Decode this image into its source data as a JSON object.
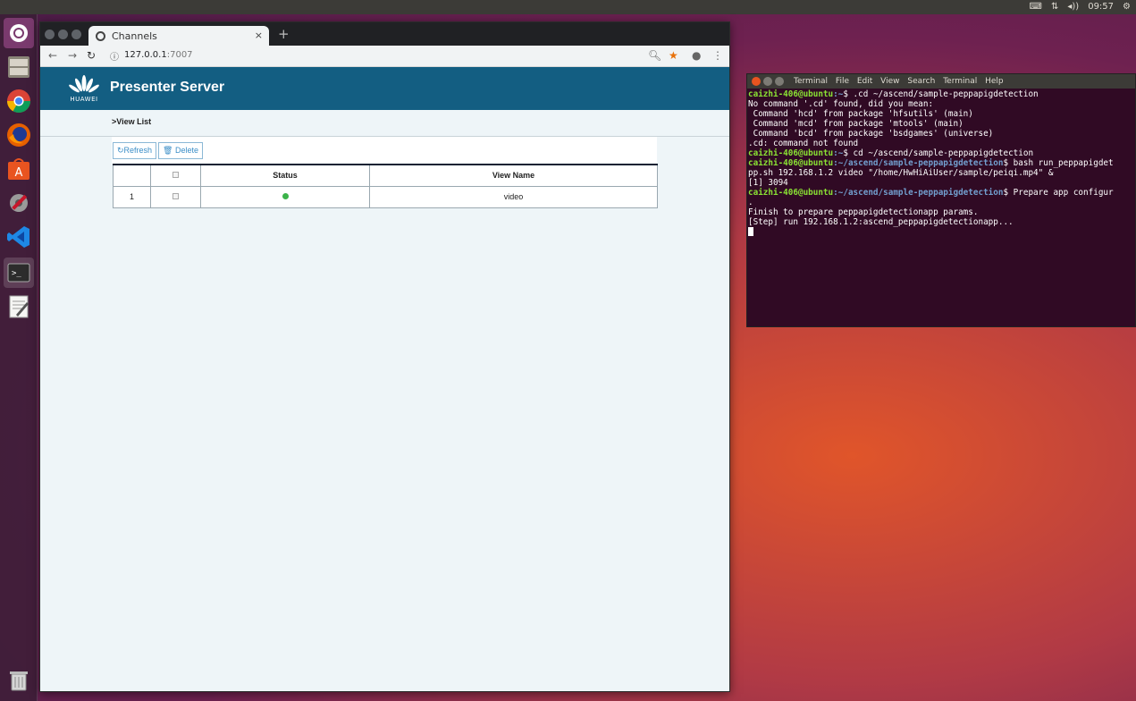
{
  "top_panel": {
    "clock": "09:57",
    "keyboard_icon": "keyboard-icon",
    "network_icon": "network-icon",
    "volume_label": "◂))",
    "settings_icon": "gear-icon"
  },
  "launcher": {
    "items": [
      {
        "name": "ubuntu-dash",
        "icon": "ubuntu-logo-icon"
      },
      {
        "name": "files",
        "icon": "file-cabinet-icon"
      },
      {
        "name": "chrome",
        "icon": "chrome-icon"
      },
      {
        "name": "firefox",
        "icon": "firefox-icon"
      },
      {
        "name": "software",
        "icon": "software-center-icon"
      },
      {
        "name": "settings",
        "icon": "tools-icon"
      },
      {
        "name": "vscode",
        "icon": "vscode-icon"
      },
      {
        "name": "terminal",
        "icon": "terminal-icon"
      },
      {
        "name": "text-editor",
        "icon": "text-editor-icon"
      },
      {
        "name": "trash",
        "icon": "trash-icon"
      }
    ]
  },
  "browser": {
    "tab_title": "Channels",
    "tab_close": "×",
    "new_tab": "+",
    "url_host": "127.0.0.1",
    "url_port": ":7007"
  },
  "page": {
    "logo_text": "HUAWEI",
    "title": "Presenter Server",
    "breadcrumb": ">View List",
    "refresh_label": "Refresh",
    "delete_label": "Delete",
    "table": {
      "headers": [
        "",
        "",
        "Status",
        "View Name"
      ],
      "rows": [
        {
          "index": "1",
          "view_name": "video",
          "status": "ok"
        }
      ]
    }
  },
  "terminal": {
    "menu": [
      "Terminal",
      "File",
      "Edit",
      "View",
      "Search",
      "Terminal",
      "Help"
    ],
    "prompt_user": "caizhi-406@ubuntu",
    "lines": [
      {
        "path": ":~",
        "cmd": "$ .cd ~/ascend/sample-peppapigdetection"
      },
      {
        "text": "No command '.cd' found, did you mean:"
      },
      {
        "text": " Command 'hcd' from package 'hfsutils' (main)"
      },
      {
        "text": " Command 'mcd' from package 'mtools' (main)"
      },
      {
        "text": " Command 'bcd' from package 'bsdgames' (universe)"
      },
      {
        "text": ".cd: command not found"
      },
      {
        "path": ":~",
        "cmd": "$ cd ~/ascend/sample-peppapigdetection"
      },
      {
        "path": ":~/ascend/sample-peppapigdetection",
        "cmd": "$ bash run_peppapigdet"
      },
      {
        "text": "pp.sh 192.168.1.2 video \"/home/HwHiAiUser/sample/peiqi.mp4\" &"
      },
      {
        "text": "[1] 3094"
      },
      {
        "path": ":~/ascend/sample-peppapigdetection",
        "cmd": "$ Prepare app configur"
      },
      {
        "text": "."
      },
      {
        "text": "Finish to prepare peppapigdetectionapp params."
      },
      {
        "text": "[Step] run 192.168.1.2:ascend_peppapigdetectionapp..."
      }
    ]
  }
}
